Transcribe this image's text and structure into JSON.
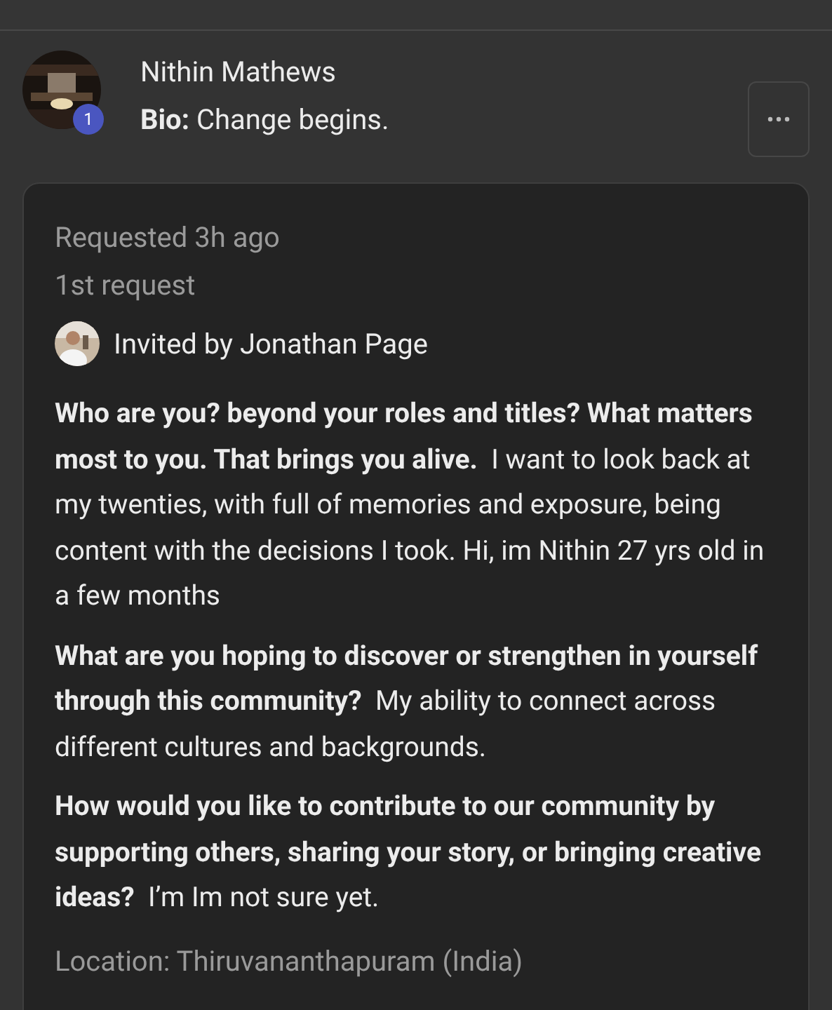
{
  "member": {
    "name": "Nithin Mathews",
    "badge": "1",
    "bio_label": "Bio:",
    "bio": "Change begins."
  },
  "request": {
    "time": "Requested 3h ago",
    "count": "1st request",
    "invited_by": "Invited by Jonathan Page",
    "answers": [
      {
        "text": "**Who are you? beyond your roles and titles? What matters most to you. That brings you alive.**  I want to look back at my twenties, with full of memories and exposure, being content with the decisions I took. Hi, im Nithin 27 yrs old in a few months"
      },
      {
        "text": "**What are you hoping to discover or strengthen in yourself through this community?**  My ability to connect across different cultures and backgrounds."
      },
      {
        "text": "**How would you like to contribute to our community by supporting others, sharing your story, or bringing creative ideas?**  I’m Im not sure yet."
      }
    ],
    "location": "Location: Thiruvananthapuram (India)"
  }
}
